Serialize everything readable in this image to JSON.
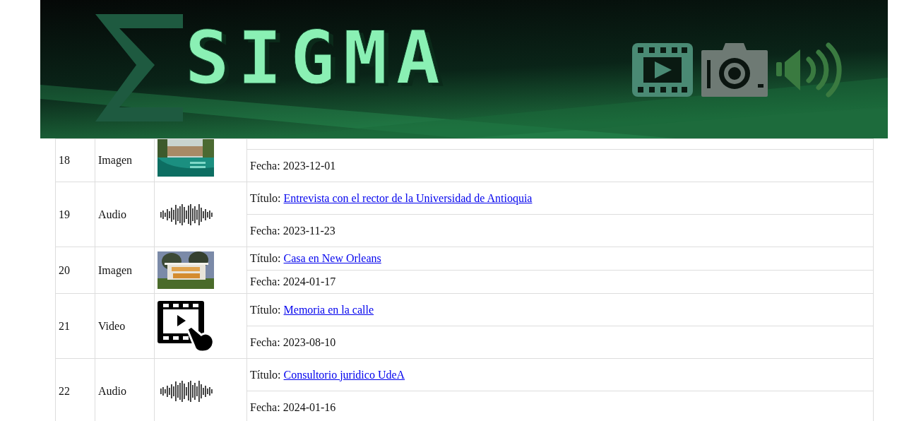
{
  "banner": {
    "logo": "SIGMA"
  },
  "rows": [
    {
      "id": "18",
      "type": "Imagen",
      "kind": "picture",
      "fecha_label": "Fecha:",
      "fecha": "2023-12-01"
    },
    {
      "id": "19",
      "type": "Audio",
      "kind": "waveform",
      "title_label": "Título:",
      "title": "Entrevista con el rector de la Universidad de Antioquia",
      "fecha_label": "Fecha:",
      "fecha": "2023-11-23"
    },
    {
      "id": "20",
      "type": "Imagen",
      "kind": "picture",
      "title_label": "Título:",
      "title": "Casa en New Orleans",
      "fecha_label": "Fecha:",
      "fecha": "2024-01-17"
    },
    {
      "id": "21",
      "type": "Video",
      "kind": "video",
      "title_label": "Título:",
      "title": "Memoria en la calle",
      "fecha_label": "Fecha:",
      "fecha": "2023-08-10"
    },
    {
      "id": "22",
      "type": "Audio",
      "kind": "waveform",
      "title_label": "Título:",
      "title": "Consultorio juridico UdeA",
      "fecha_label": "Fecha:",
      "fecha": "2024-01-16"
    }
  ]
}
